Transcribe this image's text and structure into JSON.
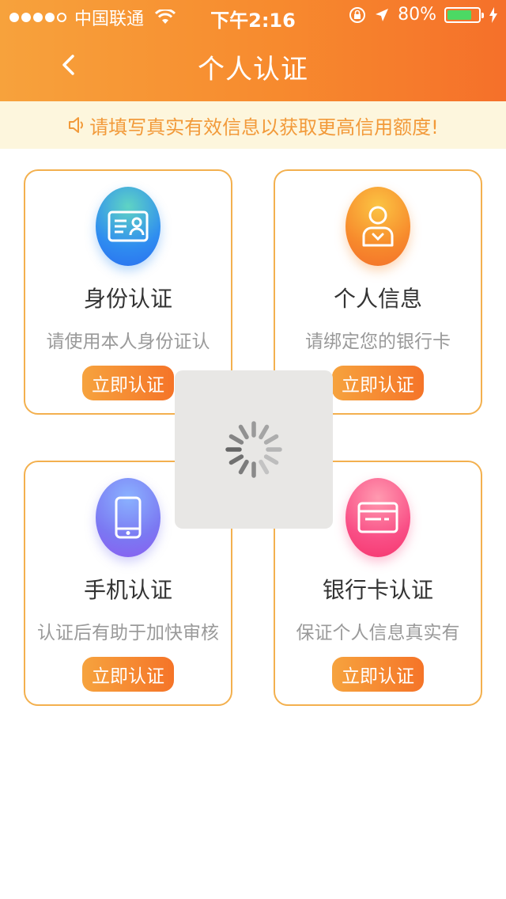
{
  "status_bar": {
    "carrier": "中国联通",
    "time": "下午2:16",
    "battery": "80%"
  },
  "nav": {
    "title": "个人认证"
  },
  "notice": {
    "text": "请填写真实有效信息以获取更高信用额度!"
  },
  "cards": [
    {
      "title": "身份认证",
      "desc": "请使用本人身份证认",
      "button": "立即认证",
      "icon": "id-card-icon"
    },
    {
      "title": "个人信息",
      "desc": "请绑定您的银行卡",
      "button": "立即认证",
      "icon": "person-icon"
    },
    {
      "title": "手机认证",
      "desc": "认证后有助于加快审核",
      "button": "立即认证",
      "icon": "phone-icon"
    },
    {
      "title": "银行卡认证",
      "desc": "保证个人信息真实有",
      "button": "立即认证",
      "icon": "bank-card-icon"
    }
  ],
  "colors": {
    "header_start": "#f7a23c",
    "header_end": "#f5702a",
    "card_border": "#f3b04e",
    "notice_bg": "#fdf6dd",
    "notice_text": "#f29a3a"
  }
}
